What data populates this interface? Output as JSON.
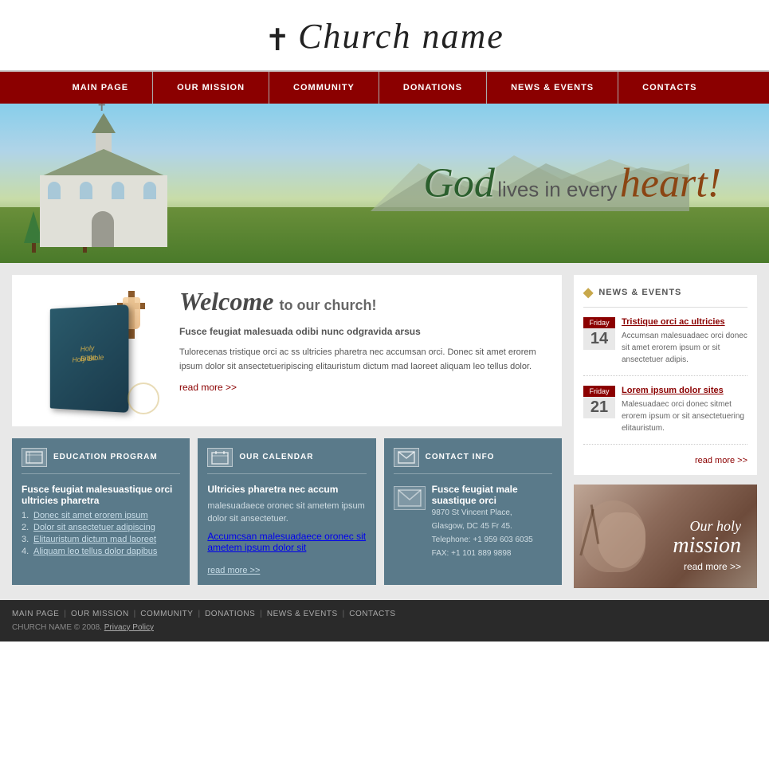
{
  "header": {
    "cross": "✝",
    "title": "Church name"
  },
  "nav": {
    "items": [
      {
        "label": "MAIN PAGE",
        "id": "main-page"
      },
      {
        "label": "OUR MISSION",
        "id": "our-mission"
      },
      {
        "label": "COMMUNITY",
        "id": "community"
      },
      {
        "label": "DONATIONS",
        "id": "donations"
      },
      {
        "label": "NEWS & EVENTS",
        "id": "news-events"
      },
      {
        "label": "CONTACTS",
        "id": "contacts"
      }
    ]
  },
  "banner": {
    "tagline_god": "God",
    "tagline_middle": "lives in every",
    "tagline_heart": "heart!"
  },
  "welcome": {
    "heading_welcome": "Welcome",
    "heading_rest": "to our church!",
    "intro_bold": "Fusce feugiat malesuada odibi nunc odgravida arsus",
    "body_text": "Tulorecenas tristique orci ac ss ultricies pharetra nec accumsan orci. Donec sit amet erorem ipsum dolor sit ansectetueripiscing elitauristum dictum mad laoreet aliquam leo tellus dolor.",
    "read_more": "read more >>"
  },
  "education": {
    "icon": "▦",
    "header": "EDUCATION PROGRAM",
    "heading": "Fusce feugiat malesuastique orci ultricies pharetra",
    "list": [
      "Donec sit amet erorem ipsum",
      "Dolor sit ansectetuer adipiscing",
      "Elitauristum dictum mad laoreet",
      "Aliquam leo tellus dolor dapibus"
    ]
  },
  "calendar": {
    "icon": "▦",
    "header": "OUR CALENDAR",
    "heading": "Ultricies pharetra nec accum",
    "body": "malesuadaece oronec sit ametem ipsum dolor sit ansectetuer.",
    "link_text": "Accumcsan malesuadaece oronec sit ametem ipsum dolor sit",
    "read_more": "read more >>"
  },
  "contact_info": {
    "icon": "▦",
    "header": "CONTACT INFO",
    "heading": "Fusce feugiat male suastique orci",
    "address": "9870 St Vincent Place,",
    "city": "Glasgow, DC 45 Fr 45.",
    "telephone": "Telephone:  +1 959 603 6035",
    "fax": "FAX:         +1 101 889 9898"
  },
  "news_events": {
    "header": "NEWS & EVENTS",
    "icon": "◆",
    "items": [
      {
        "day_label": "Friday",
        "day_num": "14",
        "title": "Tristique orci ac ultricies",
        "body": "Accumsan malesuadaec orci donec sit amet erorem ipsum or sit ansectetuer adipis."
      },
      {
        "day_label": "Friday",
        "day_num": "21",
        "title": "Lorem ipsum dolor sites",
        "body": "Malesuadaec orci donec sitmet erorem ipsum or sit ansectetuering elitauristum."
      }
    ],
    "read_more": "read more >>"
  },
  "mission": {
    "our": "Our holy",
    "mission": "mission",
    "read_more": "read more >>"
  },
  "footer": {
    "nav_items": [
      {
        "label": "MAIN PAGE"
      },
      {
        "label": "OUR MISSION"
      },
      {
        "label": "COMMUNITY"
      },
      {
        "label": "DONATIONS"
      },
      {
        "label": "NEWS & EVENTS"
      },
      {
        "label": "CONTACTS"
      }
    ],
    "copyright": "CHURCH NAME © 2008.",
    "privacy": "Privacy Policy"
  }
}
